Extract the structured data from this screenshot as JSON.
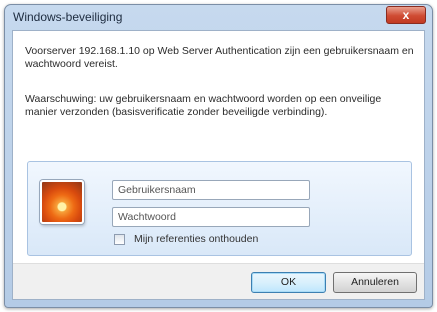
{
  "window": {
    "title": "Windows-beveiliging",
    "close_glyph": "x"
  },
  "message": {
    "line1": "Voorserver 192.168.1.10 op Web Server Authentication zijn een gebruikersnaam en wachtwoord vereist.",
    "line2": "Waarschuwing: uw gebruikersnaam en wachtwoord worden op een onveilige manier verzonden (basisverificatie zonder beveiligde verbinding)."
  },
  "credentials": {
    "user_tile_icon": "user-tile-flower-icon",
    "username_placeholder": "Gebruikersnaam",
    "password_placeholder": "Wachtwoord",
    "remember_label": "Mijn referenties onthouden",
    "remember_checked": false
  },
  "buttons": {
    "ok_label": "OK",
    "cancel_label": "Annuleren"
  },
  "colors": {
    "close_button": "#cf4b33",
    "default_button_accent": "#3c7fb1",
    "panel_border": "#a9c3e2"
  }
}
